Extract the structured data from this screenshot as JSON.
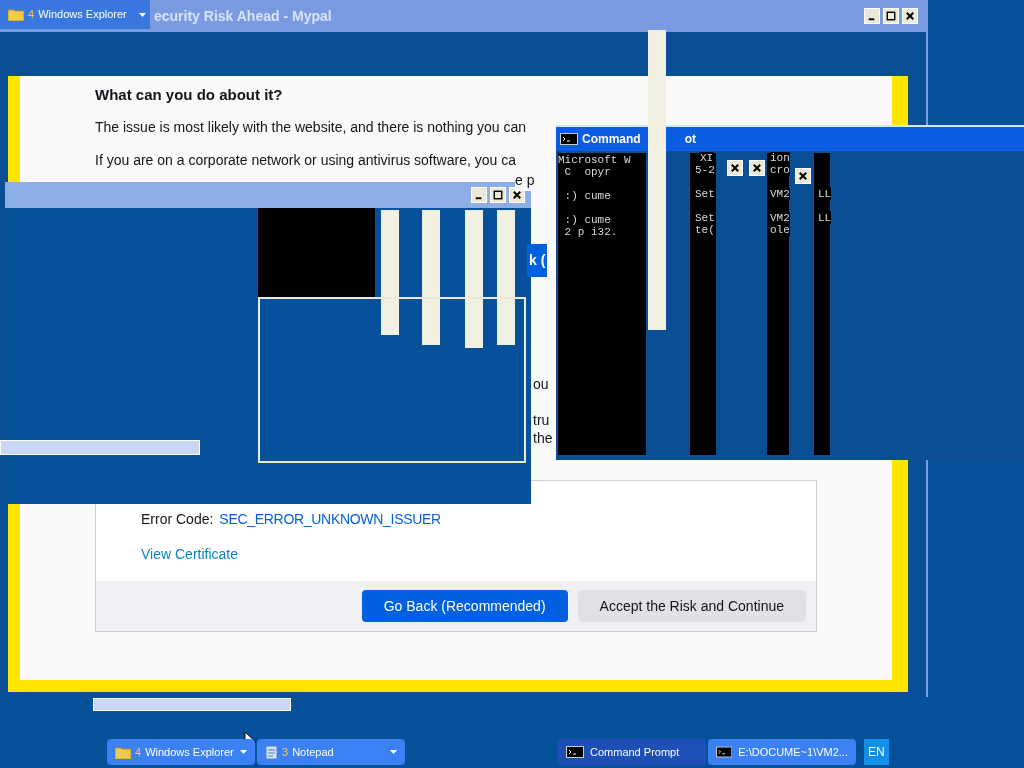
{
  "ghost_taskbar_button": {
    "number": "4",
    "label": "Windows Explorer"
  },
  "browser": {
    "title": "ecurity Risk Ahead - Mypal",
    "heading": "What can you do about it?",
    "paragraphs": [
      "The issue is most likely with the website, and there is nothing you can",
      "If you are on a corporate network or using antivirus software, you ca"
    ],
    "fragments": [
      {
        "text": "e p",
        "kind": "text"
      },
      {
        "text": "k (",
        "kind": "button"
      },
      {
        "text": "ou",
        "kind": "text"
      },
      {
        "text": "tru",
        "kind": "text"
      },
      {
        "text": "the",
        "kind": "text"
      }
    ],
    "error_label": "Error Code:",
    "error_code": "SEC_ERROR_UNKNOWN_ISSUER",
    "link": "View Certificate",
    "buttons": [
      {
        "label": "Go Back (Recommended)",
        "kind": "primary"
      },
      {
        "label": "Accept the Risk and Continue",
        "kind": "secondary"
      }
    ]
  },
  "console": {
    "title": "Command",
    "title_tail": "ot",
    "lines": [
      "Microsoft W",
      " C  opyr",
      " :) cume",
      " :) cume",
      " 2 p i32."
    ],
    "right_fragments": [
      "XI",
      "5-2",
      "Set",
      "Set",
      "te(",
      "ion",
      "cro",
      "VM2",
      "VM2",
      "ole",
      "LL",
      "LL"
    ]
  },
  "taskbar": {
    "buttons": [
      {
        "number": "4",
        "label": "Windows Explorer",
        "kind": "folder",
        "selected": false
      },
      {
        "number": "3",
        "label": "Notepad",
        "kind": "notepad",
        "selected": false
      },
      {
        "label": "Command Prompt",
        "kind": "console",
        "selected": true
      },
      {
        "label": "E:\\DOCUME~1\\VM2...",
        "kind": "console",
        "selected": false
      }
    ],
    "language": "EN"
  }
}
